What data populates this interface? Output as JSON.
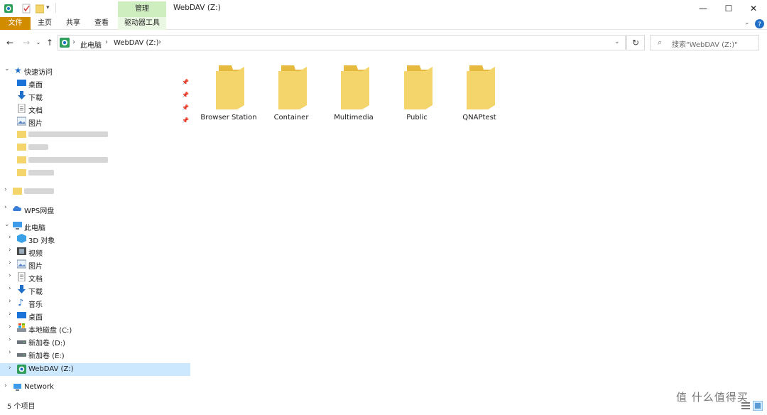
{
  "window": {
    "title": "WebDAV (Z:)",
    "minimize": "—",
    "maximize": "☐",
    "close": "✕"
  },
  "ribbon": {
    "context_group": "管理",
    "tabs": [
      "文件",
      "主页",
      "共享",
      "查看",
      "驱动器工具"
    ]
  },
  "address": {
    "crumbs": [
      "此电脑",
      "WebDAV (Z:)"
    ],
    "search_placeholder": "搜索\"WebDAV (Z:)\""
  },
  "sidebar": {
    "quick_access": "快速访问",
    "pinned": [
      "桌面",
      "下载",
      "文档",
      "图片"
    ],
    "wps": "WPS网盘",
    "this_pc": "此电脑",
    "pc_items": [
      "3D 对象",
      "视频",
      "图片",
      "文档",
      "下载",
      "音乐",
      "桌面",
      "本地磁盘 (C:)",
      "新加卷 (D:)",
      "新加卷 (E:)",
      "WebDAV (Z:)"
    ],
    "network": "Network"
  },
  "content": {
    "folders": [
      "Browser Station",
      "Container",
      "Multimedia",
      "Public",
      "QNAPtest"
    ]
  },
  "status": {
    "count": "5 个项目"
  },
  "watermark": "值 什么值得买",
  "colors": {
    "accent": "#0078d7",
    "file_tab": "#d28c00",
    "manage": "#cfeec0",
    "selected": "#cce8ff",
    "folder": "#f3d56b"
  }
}
